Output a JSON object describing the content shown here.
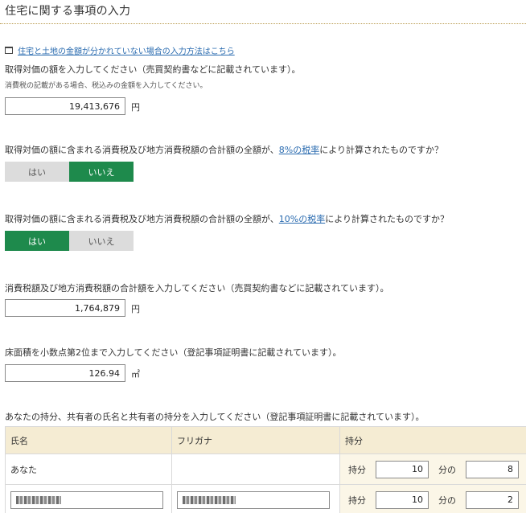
{
  "page": {
    "title": "住宅に関する事項の入力"
  },
  "help_link": {
    "label": "住宅と土地の金額が分かれていない場合の入力方法はこちら"
  },
  "price": {
    "label": "取得対価の額を入力してください（売買契約書などに記載されています）。",
    "note": "消費税の記載がある場合、税込みの金額を入力してください。",
    "value": "19,413,676",
    "unit": "円"
  },
  "tax8": {
    "label_before": "取得対価の額に含まれる消費税及び地方消費税額の合計額の全額が、",
    "link": "8%の税率",
    "label_after": "により計算されたものですか？",
    "yes": "はい",
    "no": "いいえ",
    "selected": "no"
  },
  "tax10": {
    "label_before": "取得対価の額に含まれる消費税及び地方消費税額の合計額の全額が、",
    "link": "10%の税率",
    "label_after": "により計算されたものですか？",
    "yes": "はい",
    "no": "いいえ",
    "selected": "yes"
  },
  "tax_total": {
    "label": "消費税額及び地方消費税額の合計額を入力してください（売買契約書などに記載されています）。",
    "value": "1,764,879",
    "unit": "円"
  },
  "floor_area": {
    "label": "床面積を小数点第2位まで入力してください（登記事項証明書に記載されています）。",
    "value": "126.94",
    "unit": "㎡"
  },
  "ownership": {
    "label": "あなたの持分、共有者の氏名と共有者の持分を入力してください（登記事項証明書に記載されています）。",
    "headers": [
      "氏名",
      "フリガナ",
      "持分"
    ],
    "share_label": "持分",
    "of_label": "分の",
    "rows": [
      {
        "name": "あなた",
        "kana": "",
        "numerator": "10",
        "denominator": "8"
      },
      {
        "name": "",
        "kana": "",
        "numerator": "10",
        "denominator": "2"
      }
    ]
  },
  "colors": {
    "selected_green": "#1e8a4c",
    "unselected_gray": "#dcdcdc",
    "header_beige": "#f5ecd3",
    "link_blue": "#2b6cb0"
  }
}
